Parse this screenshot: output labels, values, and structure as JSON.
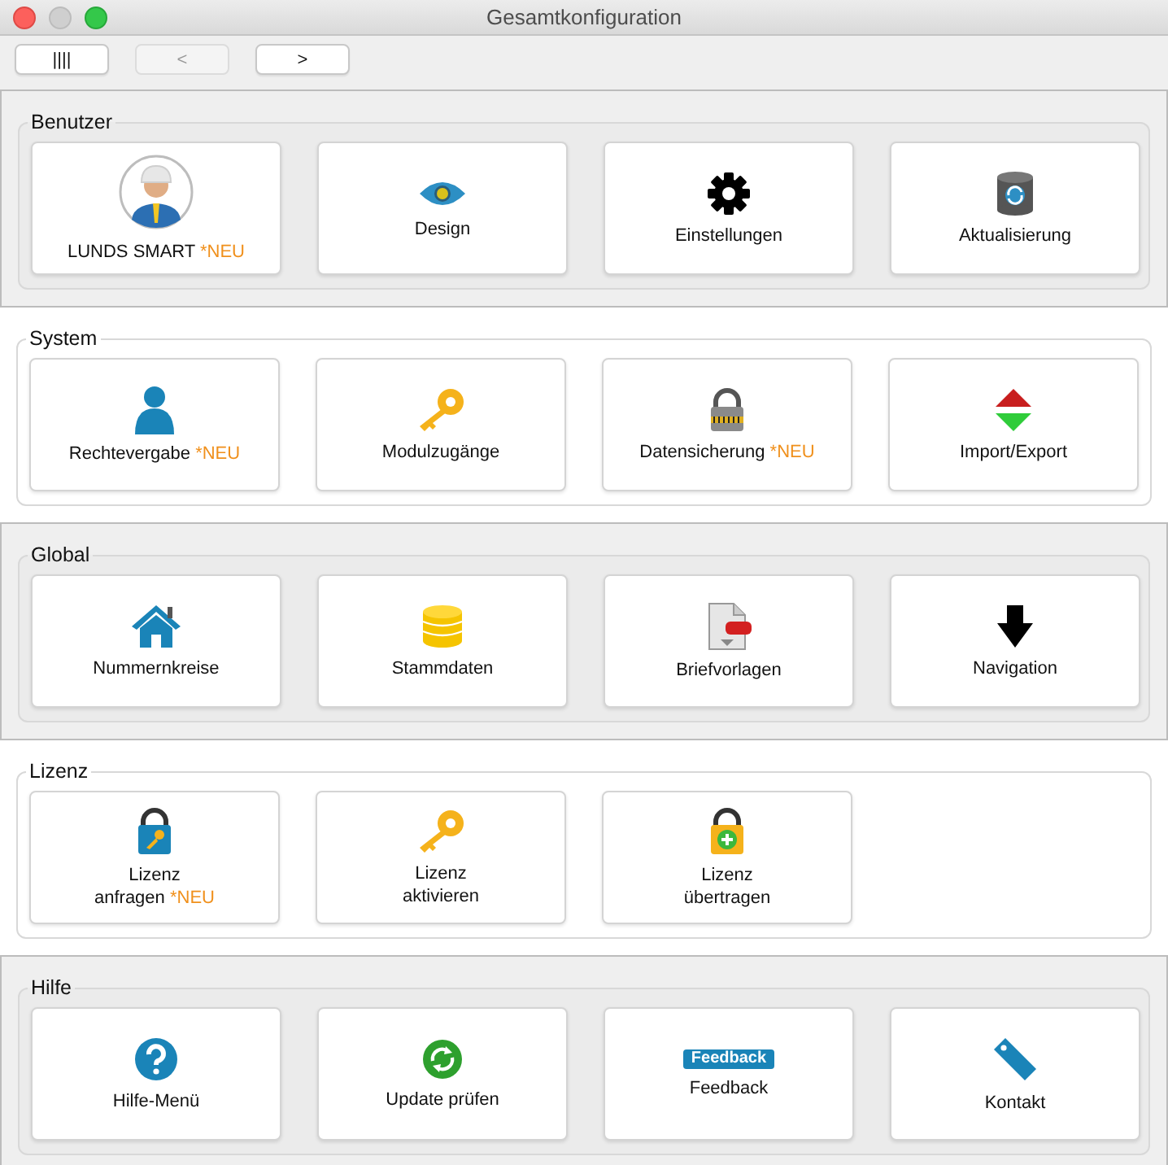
{
  "window": {
    "title": "Gesamtkonfiguration"
  },
  "toolbar": [
    {
      "label": "||||",
      "disabled": false
    },
    {
      "label": "<",
      "disabled": true
    },
    {
      "label": ">",
      "disabled": false
    }
  ],
  "sections": [
    {
      "title": "Benutzer",
      "items": [
        {
          "kind": "avatar",
          "lines": [
            "LUNDS SMART"
          ],
          "badge": "*NEU"
        },
        {
          "kind": "eye",
          "lines": [
            "Design"
          ]
        },
        {
          "kind": "gear",
          "lines": [
            "Einstellungen"
          ]
        },
        {
          "kind": "database",
          "lines": [
            "Aktualisierung"
          ]
        }
      ]
    },
    {
      "title": "System",
      "items": [
        {
          "kind": "person",
          "lines": [
            "Rechtevergabe"
          ],
          "badge": "*NEU"
        },
        {
          "kind": "key",
          "lines": [
            "Modulzugänge"
          ]
        },
        {
          "kind": "padlock",
          "lines": [
            "Datensicherung"
          ],
          "badge": "*NEU"
        },
        {
          "kind": "updown",
          "lines": [
            "Import/Export"
          ]
        }
      ]
    },
    {
      "title": "Global",
      "items": [
        {
          "kind": "house",
          "lines": [
            "Nummernkreise"
          ]
        },
        {
          "kind": "coins",
          "lines": [
            "Stammdaten"
          ]
        },
        {
          "kind": "pdf",
          "lines": [
            "Briefvorlagen"
          ]
        },
        {
          "kind": "down",
          "lines": [
            "Navigation"
          ]
        }
      ]
    },
    {
      "title": "Lizenz",
      "items": [
        {
          "kind": "lockkey",
          "lines": [
            "Lizenz",
            "anfragen"
          ],
          "badge": "*NEU"
        },
        {
          "kind": "key",
          "lines": [
            "Lizenz",
            "aktivieren"
          ]
        },
        {
          "kind": "lockplus",
          "lines": [
            "Lizenz",
            "übertragen"
          ]
        }
      ]
    },
    {
      "title": "Hilfe",
      "items": [
        {
          "kind": "help",
          "lines": [
            "Hilfe-Menü"
          ]
        },
        {
          "kind": "refresh",
          "lines": [
            "Update prüfen"
          ]
        },
        {
          "kind": "feedback",
          "icon_text": "Feedback",
          "lines": [
            "Feedback"
          ]
        },
        {
          "kind": "tag",
          "lines": [
            "Kontakt"
          ]
        }
      ]
    }
  ]
}
